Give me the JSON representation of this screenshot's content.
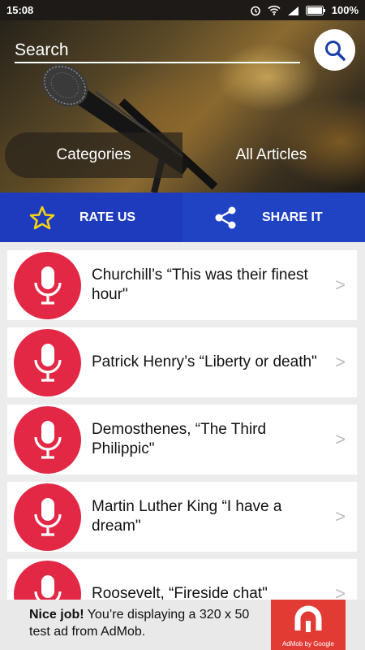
{
  "status_bar": {
    "time": "15:08",
    "battery": "100%",
    "icons": [
      "alarm-icon",
      "wifi-icon",
      "signal-icon",
      "battery-icon"
    ]
  },
  "header": {
    "search_placeholder": "Search",
    "search_button_icon": "search-icon",
    "tabs": [
      {
        "label": "Categories"
      },
      {
        "label": "All Articles"
      }
    ]
  },
  "actions": {
    "rate_label": "RATE US",
    "rate_icon": "star-icon",
    "share_label": "SHARE IT",
    "share_icon": "share-icon"
  },
  "articles": [
    {
      "title": "Churchill’s “This was their finest hour\"",
      "icon": "microphone-icon"
    },
    {
      "title": "Patrick Henry’s “Liberty or death\"",
      "icon": "microphone-icon"
    },
    {
      "title": "Demosthenes, “The Third Philippic\"",
      "icon": "microphone-icon"
    },
    {
      "title": "Martin Luther King “I have a dream\"",
      "icon": "microphone-icon"
    },
    {
      "title": "Roosevelt, “Fireside chat\"",
      "icon": "microphone-icon"
    }
  ],
  "list_chevron": ">",
  "ad": {
    "headline": "Nice job!",
    "body": "You’re displaying a 320 x 50 test ad from AdMob.",
    "brand": "AdMob by Google"
  },
  "colors": {
    "action_bar": "#1e3bbd",
    "accent_red": "#e32845",
    "star_yellow": "#f5d314",
    "ad_red": "#e23b34"
  }
}
